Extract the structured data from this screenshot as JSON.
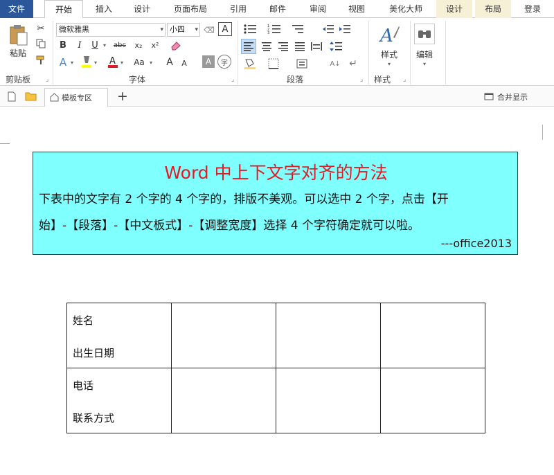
{
  "menu": {
    "tabs": [
      "文件",
      "开始",
      "插入",
      "设计",
      "页面布局",
      "引用",
      "邮件",
      "审阅",
      "视图",
      "美化大师",
      "设计",
      "布局"
    ],
    "login": "登录"
  },
  "ribbon": {
    "clipboard": {
      "paste_label": "粘贴",
      "group_label": "剪贴板"
    },
    "font": {
      "font_name": "微软雅黑",
      "font_size": "小四",
      "bold": "B",
      "italic": "I",
      "underline": "U",
      "strike": "abc",
      "subscript": "x₂",
      "superscript": "x²",
      "grow": "A",
      "shrink": "A",
      "case": "Aa",
      "char_shade": "A",
      "enclose": "字",
      "group_label": "字体"
    },
    "paragraph": {
      "group_label": "段落"
    },
    "styles": {
      "styles_label": "样式",
      "group_label": "样式"
    },
    "editing": {
      "edit_label": "编辑"
    }
  },
  "tabstrip": {
    "doc_tab": "模板专区",
    "add": "+",
    "merge_label": "合并显示"
  },
  "document": {
    "note_title": "Word 中上下文字对齐的方法",
    "note_line1": "下表中的文字有 2 个字的 4 个字的，排版不美观。可以选中 2 个字，点击【开",
    "note_line2": "始】-【段落】-【中文板式】-【调整宽度】选择 4 个字符确定就可以啦。",
    "note_sign": "---office2013",
    "table": [
      [
        "姓名",
        "出生日期"
      ],
      [
        "电话",
        "联系方式"
      ]
    ]
  }
}
